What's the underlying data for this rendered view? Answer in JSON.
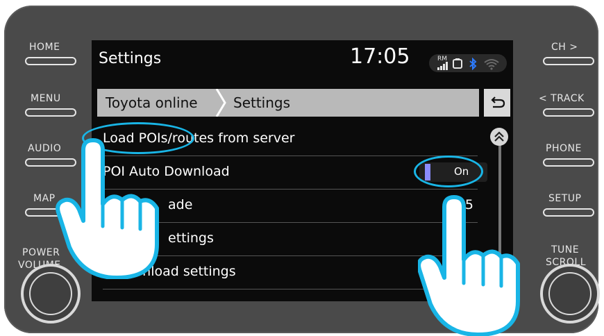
{
  "bezel": {
    "left_buttons": [
      "HOME",
      "MENU",
      "AUDIO",
      "MAP",
      "POWER",
      "VOLUME"
    ],
    "right_buttons": [
      "CH >",
      "< TRACK",
      "PHONE",
      "SETUP",
      "TUNE",
      "SCROLL"
    ]
  },
  "screen": {
    "title": "Settings",
    "time": "17:05",
    "status": {
      "rm": "RM",
      "icons": [
        "signal-icon",
        "battery-icon",
        "bluetooth-icon",
        "wifi-icon"
      ]
    },
    "breadcrumb": {
      "item1": "Toyota online",
      "item2": "Settings"
    },
    "rows": [
      {
        "label": "Load POIs/routes from server",
        "value": ""
      },
      {
        "label": "POI Auto Download",
        "toggle": "On"
      },
      {
        "label": "ade",
        "value": "5"
      },
      {
        "label": "ettings",
        "value": ""
      },
      {
        "label": "ownload settings",
        "value": ""
      }
    ]
  },
  "colors": {
    "bezel": "#4a4a4a",
    "screen": "#0b0b0b",
    "accent": "#19b5e6",
    "toggle_on": "#8a8cff"
  }
}
